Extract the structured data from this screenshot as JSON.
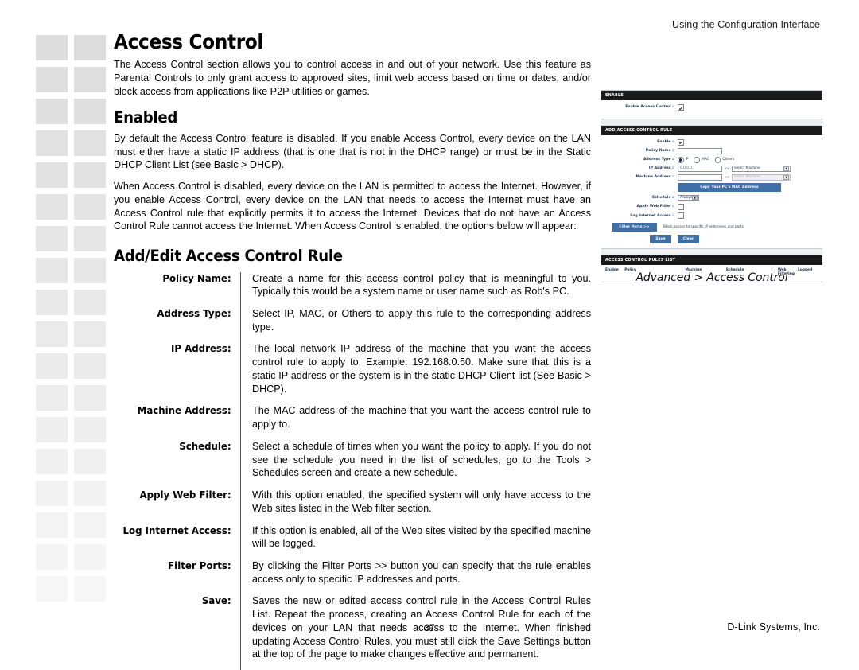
{
  "header": {
    "running_head": "Using the Configuration Interface"
  },
  "content": {
    "section_title": "Access Control",
    "intro_paragraph": "The Access Control section allows you to control access in and out of your network. Use this feature as Parental Controls to only grant access to approved sites, limit web access based on time or dates, and/or block access from applications like P2P utilities or games.",
    "enabled_title": "Enabled",
    "enabled_paragraph_1": "By default the Access Control feature is disabled. If you enable Access Control, every device on the LAN must either have a static IP address (that is one that is not in the DHCP range) or must be in the Static DHCP Client List (see Basic > DHCP).",
    "enabled_paragraph_2": "When Access Control is disabled, every device on the LAN is permitted to access the Internet. However, if you enable Access Control, every device on the LAN that needs to access the Internet must have an Access Control rule that explicitly permits it to access the Internet. Devices that do not have an Access Control Rule cannot access the Internet. When Access Control is enabled, the options below will appear:",
    "rule_title": "Add/Edit Access Control Rule",
    "definitions": [
      {
        "term": "Policy Name:",
        "desc": "Create a name for this access control policy that is meaningful to you. Typically this would be a system name or user name such as Rob's PC."
      },
      {
        "term": "Address Type:",
        "desc": "Select IP, MAC, or Others to apply this rule to the corresponding address type."
      },
      {
        "term": "IP Address:",
        "desc": "The local network IP address of the machine that you want the access control rule to apply to. Example: 192.168.0.50. Make sure that this is a static IP address or the system is in the static DHCP Client list (See Basic > DHCP)."
      },
      {
        "term": "Machine Address:",
        "desc": "The MAC address of the machine that you want the access control rule to apply to."
      },
      {
        "term": "Schedule:",
        "desc": "Select a schedule of times when you want the policy to apply. If you do not see the schedule you need in the list of schedules, go to the Tools > Schedules screen and create a new schedule."
      },
      {
        "term": "Apply Web Filter:",
        "desc": "With this option enabled, the specified system will only have access to the Web sites listed in the Web filter section."
      },
      {
        "term": "Log Internet Access:",
        "desc": "If this option is enabled, all of the Web sites visited by the specified machine will be logged."
      },
      {
        "term": "Filter Ports:",
        "desc": "By clicking the Filter Ports >> button you can specify that the rule enables access only to specific IP addresses and ports."
      },
      {
        "term": "Save:",
        "desc": "Saves the new or edited access control rule in the Access Control Rules List. Repeat the process, creating an Access Control Rule for each of the devices on your LAN that needs access to the Internet. When finished updating Access Control Rules, you must still click the Save Settings button at the top of the page to make changes effective and permanent."
      }
    ]
  },
  "figure": {
    "caption": "Advanced > Access Control",
    "enable_panel": {
      "bar_title": "ENABLE",
      "enable_access_control_label": "Enable Access Control :",
      "enable_access_control_checked": true
    },
    "add_rule_panel": {
      "bar_title": "ADD ACCESS CONTROL RULE",
      "enable_label": "Enable :",
      "enable_checked": true,
      "policy_name_label": "Policy Name :",
      "policy_name_value": "",
      "address_type_label": "Address Type :",
      "address_type_options": [
        "IP",
        "MAC",
        "Others"
      ],
      "address_type_selected": "IP",
      "ip_address_label": "IP Address :",
      "ip_address_value": "0.0.0.0",
      "ip_select_machine": "Select Machine",
      "machine_address_label": "Machine Address :",
      "machine_address_value": "",
      "machine_select_machine": "Select Machine",
      "copy_mac_button": "Copy Your PC's MAC Address",
      "schedule_label": "Schedule :",
      "schedule_value": "Always",
      "apply_web_filter_label": "Apply Web Filter :",
      "apply_web_filter_checked": false,
      "log_internet_access_label": "Log Internet Access :",
      "log_internet_access_checked": false,
      "filter_ports_button": "Filter Ports >>",
      "filter_ports_note": "Block access to specific IP addresses and ports.",
      "save_button": "Save",
      "clear_button": "Clear",
      "arrows_glyph": "<<"
    },
    "rules_list_panel": {
      "bar_title": "ACCESS CONTROL RULES LIST",
      "columns": [
        "Enable",
        "Policy",
        "Machine",
        "Schedule",
        "Web Filtering",
        "Logged"
      ]
    }
  },
  "footer": {
    "page_number": "37",
    "brand": "D-Link Systems, Inc."
  },
  "colors": {
    "bar_background": "#1a1a1a",
    "button_blue": "#3f6fa5",
    "deco_square": "#dcdcdc",
    "text": "#000000"
  }
}
